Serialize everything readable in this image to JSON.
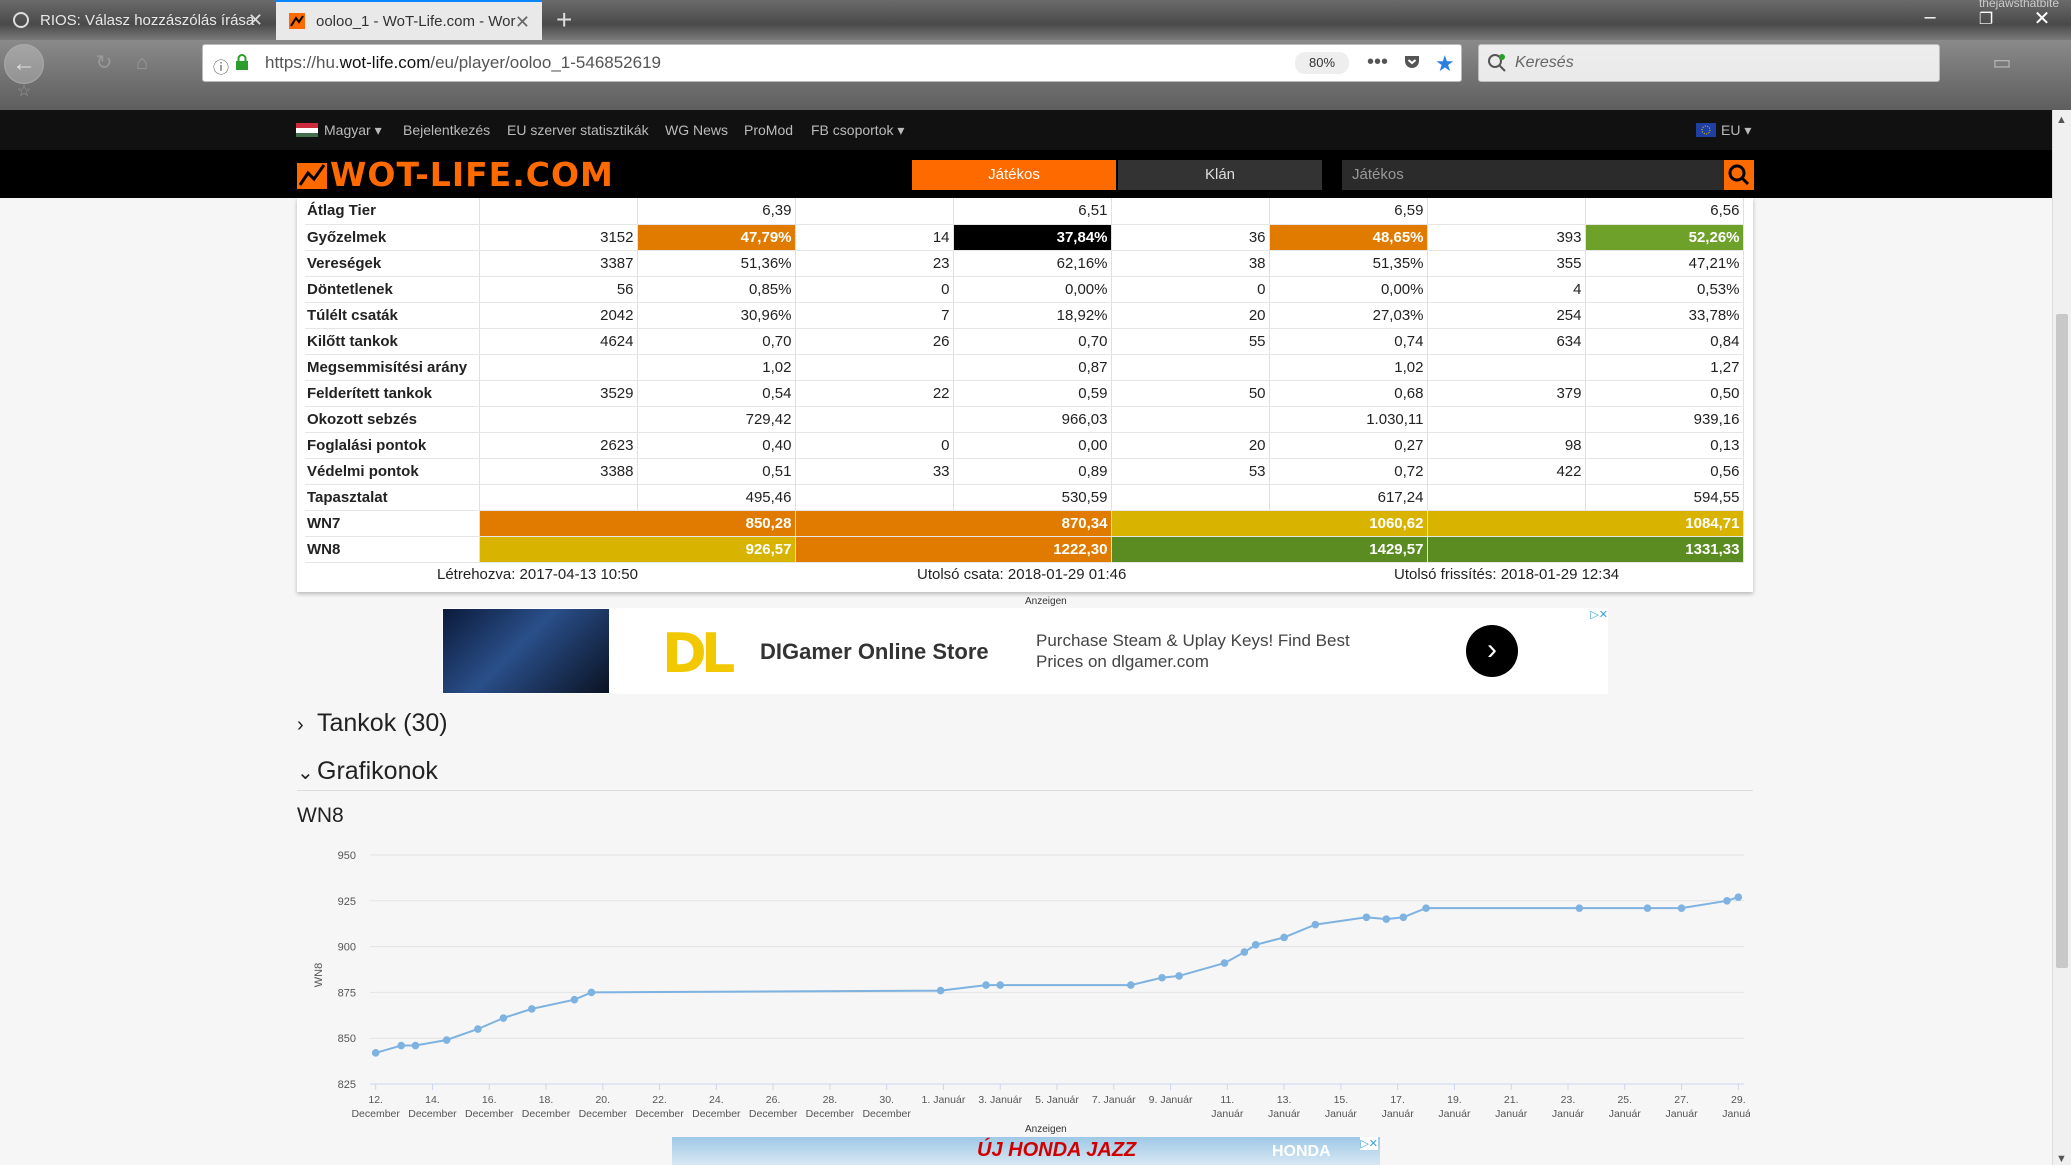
{
  "browser": {
    "tabs": [
      {
        "title": "RIOS: Válasz hozzászólás írása"
      },
      {
        "title": "ooloo_1 - WoT-Life.com - Wor"
      }
    ],
    "url_prefix": "https://hu.",
    "url_domain": "wot-life.com",
    "url_path": "/eu/player/ooloo_1-546852619",
    "zoom": "80%",
    "search_placeholder": "Keresés",
    "user_label": "thejawsthatbite"
  },
  "site": {
    "language": "Magyar",
    "nav": [
      "Bejelentkezés",
      "EU szerver statisztikák",
      "WG News",
      "ProMod",
      "FB csoportok"
    ],
    "region": "EU",
    "logo": "WOT-LIFE.COM",
    "tab_player": "Játékos",
    "tab_clan": "Klán",
    "search_placeholder": "Játékos"
  },
  "stats": {
    "rows": [
      {
        "label": "Átlag Tier",
        "cells": [
          "",
          "6,39",
          "",
          "6,51",
          "",
          "6,59",
          "",
          "6,56"
        ]
      },
      {
        "label": "Győzelmek",
        "cells": [
          "3152",
          "47,79%",
          "14",
          "37,84%",
          "36",
          "48,65%",
          "393",
          "52,26%"
        ]
      },
      {
        "label": "Vereségek",
        "cells": [
          "3387",
          "51,36%",
          "23",
          "62,16%",
          "38",
          "51,35%",
          "355",
          "47,21%"
        ]
      },
      {
        "label": "Döntetlenek",
        "cells": [
          "56",
          "0,85%",
          "0",
          "0,00%",
          "0",
          "0,00%",
          "4",
          "0,53%"
        ]
      },
      {
        "label": "Túlélt csaták",
        "cells": [
          "2042",
          "30,96%",
          "7",
          "18,92%",
          "20",
          "27,03%",
          "254",
          "33,78%"
        ]
      },
      {
        "label": "Kilőtt tankok",
        "cells": [
          "4624",
          "0,70",
          "26",
          "0,70",
          "55",
          "0,74",
          "634",
          "0,84"
        ]
      },
      {
        "label": "Megsemmisítési arány",
        "cells": [
          "",
          "1,02",
          "",
          "0,87",
          "",
          "1,02",
          "",
          "1,27"
        ]
      },
      {
        "label": "Felderített tankok",
        "cells": [
          "3529",
          "0,54",
          "22",
          "0,59",
          "50",
          "0,68",
          "379",
          "0,50"
        ]
      },
      {
        "label": "Okozott sebzés",
        "cells": [
          "",
          "729,42",
          "",
          "966,03",
          "",
          "1.030,11",
          "",
          "939,16"
        ]
      },
      {
        "label": "Foglalási pontok",
        "cells": [
          "2623",
          "0,40",
          "0",
          "0,00",
          "20",
          "0,27",
          "98",
          "0,13"
        ]
      },
      {
        "label": "Védelmi pontok",
        "cells": [
          "3388",
          "0,51",
          "33",
          "0,89",
          "53",
          "0,72",
          "422",
          "0,56"
        ]
      },
      {
        "label": "Tapasztalat",
        "cells": [
          "",
          "495,46",
          "",
          "530,59",
          "",
          "617,24",
          "",
          "594,55"
        ]
      }
    ],
    "wn7": {
      "label": "WN7",
      "values": [
        "850,28",
        "870,34",
        "1060,62",
        "1084,71"
      ]
    },
    "wn8": {
      "label": "WN8",
      "values": [
        "926,57",
        "1222,30",
        "1429,57",
        "1331,33"
      ]
    },
    "colors": {
      "orange": "#e07b00",
      "black": "#000000",
      "green": "#6ea12a",
      "yellow": "#d8b400",
      "dark_green": "#5b8c22"
    },
    "created": "Létrehozva: 2017-04-13 10:50",
    "last_battle": "Utolsó csata: 2018-01-29 01:46",
    "last_update": "Utolsó frissítés: 2018-01-29 12:34"
  },
  "ads": {
    "label": "Anzeigen",
    "ad1_logo": "DL",
    "ad1_title": "DIGamer Online Store",
    "ad1_desc": "Purchase Steam & Uplay Keys! Find Best Prices on dlgamer.com",
    "ad2_text": "ÚJ HONDA JAZZ",
    "ad2_brand": "HONDA"
  },
  "sections": {
    "tanks": "Tankok (30)",
    "graphs": "Grafikonok"
  },
  "chart_data": {
    "type": "line",
    "title": "WN8",
    "ylabel": "WN8",
    "xlabel": "",
    "ylim": [
      825,
      950
    ],
    "yticks": [
      825,
      850,
      875,
      900,
      925,
      950
    ],
    "x_range": [
      11.8,
      60.2
    ],
    "x_unit": "days; 1-31 = December 2017, 32-60 = January 2018",
    "xticks": [
      {
        "x": 12,
        "day": "12.",
        "month": "December"
      },
      {
        "x": 14,
        "day": "14.",
        "month": "December"
      },
      {
        "x": 16,
        "day": "16.",
        "month": "December"
      },
      {
        "x": 18,
        "day": "18.",
        "month": "December"
      },
      {
        "x": 20,
        "day": "20.",
        "month": "December"
      },
      {
        "x": 22,
        "day": "22.",
        "month": "December"
      },
      {
        "x": 24,
        "day": "24.",
        "month": "December"
      },
      {
        "x": 26,
        "day": "26.",
        "month": "December"
      },
      {
        "x": 28,
        "day": "28.",
        "month": "December"
      },
      {
        "x": 30,
        "day": "30.",
        "month": "December"
      },
      {
        "x": 32,
        "day": "1. Január",
        "month": ""
      },
      {
        "x": 34,
        "day": "3. Január",
        "month": ""
      },
      {
        "x": 36,
        "day": "5. Január",
        "month": ""
      },
      {
        "x": 38,
        "day": "7. Január",
        "month": ""
      },
      {
        "x": 40,
        "day": "9. Január",
        "month": ""
      },
      {
        "x": 42,
        "day": "11.",
        "month": "Január"
      },
      {
        "x": 44,
        "day": "13.",
        "month": "Január"
      },
      {
        "x": 46,
        "day": "15.",
        "month": "Január"
      },
      {
        "x": 48,
        "day": "17.",
        "month": "Január"
      },
      {
        "x": 50,
        "day": "19.",
        "month": "Január"
      },
      {
        "x": 52,
        "day": "21.",
        "month": "Január"
      },
      {
        "x": 54,
        "day": "23.",
        "month": "Január"
      },
      {
        "x": 56,
        "day": "25.",
        "month": "Január"
      },
      {
        "x": 58,
        "day": "27.",
        "month": "Január"
      },
      {
        "x": 60,
        "day": "29.",
        "month": "Január"
      }
    ],
    "series": [
      {
        "color": "#7eb2e0",
        "points": [
          [
            12.0,
            842
          ],
          [
            12.9,
            846
          ],
          [
            13.4,
            846
          ],
          [
            14.5,
            849
          ],
          [
            15.6,
            855
          ],
          [
            16.5,
            861
          ],
          [
            17.5,
            866
          ],
          [
            19.0,
            871
          ],
          [
            19.6,
            875
          ],
          [
            31.9,
            876
          ],
          [
            33.5,
            879
          ],
          [
            34.0,
            879
          ],
          [
            38.6,
            879
          ],
          [
            39.7,
            883
          ],
          [
            40.3,
            884
          ],
          [
            41.9,
            891
          ],
          [
            42.6,
            897
          ],
          [
            43.0,
            901
          ],
          [
            44.0,
            905
          ],
          [
            45.1,
            912
          ],
          [
            46.9,
            916
          ],
          [
            47.6,
            915
          ],
          [
            48.2,
            916
          ],
          [
            49.0,
            921
          ],
          [
            54.4,
            921
          ],
          [
            56.8,
            921
          ],
          [
            58.0,
            921
          ],
          [
            59.6,
            925
          ],
          [
            60.0,
            927
          ]
        ]
      }
    ],
    "grid": true,
    "legend": "none"
  }
}
